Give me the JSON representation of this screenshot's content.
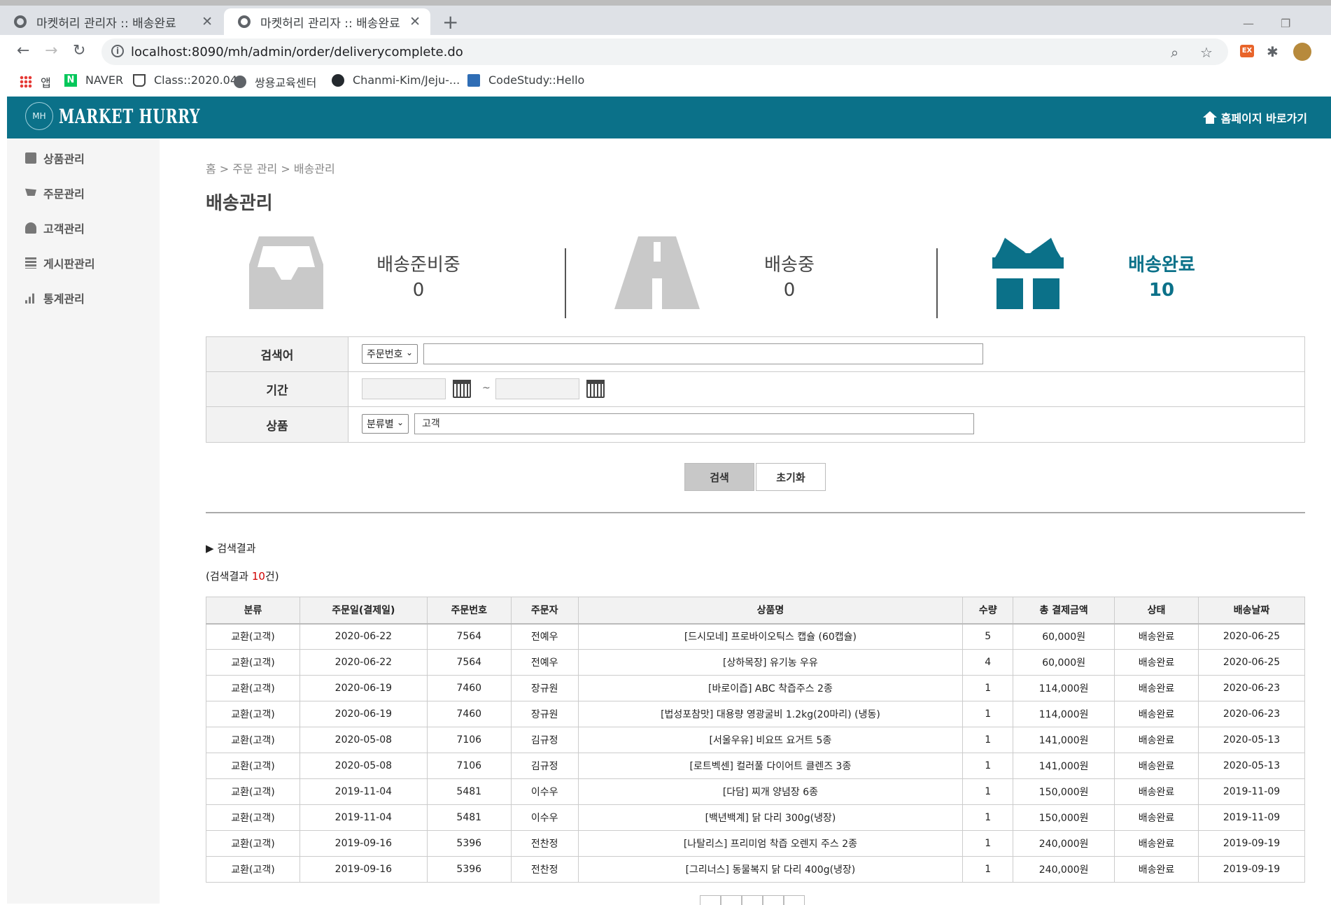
{
  "browser": {
    "tabs": [
      {
        "title": "마켓허리 관리자 :: 배송완료",
        "active": false
      },
      {
        "title": "마켓허리 관리자 :: 배송완료",
        "active": true
      }
    ],
    "url": "localhost:8090/mh/admin/order/deliverycomplete.do",
    "bookmarks": [
      {
        "label": "앱",
        "icon": "apps-icon"
      },
      {
        "label": "NAVER",
        "icon": "naver-icon"
      },
      {
        "label": "Class::2020.04",
        "icon": "coffee-icon"
      },
      {
        "label": "쌍용교육센터",
        "icon": "globe-icon"
      },
      {
        "label": "Chanmi-Kim/Jeju-...",
        "icon": "github-icon"
      },
      {
        "label": "CodeStudy::Hello",
        "icon": "monitor-icon"
      }
    ],
    "ext_ex_label": "EX"
  },
  "header": {
    "logo_mark": "MH",
    "logo_text": "MARKET HURRY",
    "home_link": "홈페이지 바로가기",
    "brand_color": "#0b7189"
  },
  "sidebar": {
    "items": [
      {
        "label": "상품관리",
        "icon": "gift-icon"
      },
      {
        "label": "주문관리",
        "icon": "cart-icon"
      },
      {
        "label": "고객관리",
        "icon": "user-icon"
      },
      {
        "label": "게시판관리",
        "icon": "list-icon"
      },
      {
        "label": "통계관리",
        "icon": "bar-chart-icon"
      }
    ]
  },
  "page": {
    "breadcrumb": "홈 > 주문 관리 > 배송관리",
    "title": "배송관리"
  },
  "status": {
    "preparing": {
      "label": "배송준비중",
      "count": "0",
      "icon": "inbox-tray-icon"
    },
    "shipping": {
      "label": "배송중",
      "count": "0",
      "icon": "road-icon"
    },
    "complete": {
      "label": "배송완료",
      "count": "10",
      "icon": "gift-box-icon",
      "active": true
    }
  },
  "search": {
    "keyword_label": "검색어",
    "keyword_select": "주문번호",
    "keyword_value": "",
    "period_label": "기간",
    "period_from": "",
    "period_to": "",
    "period_sep": "~",
    "product_label": "상품",
    "product_select": "분류별",
    "product_value": "고객",
    "search_button": "검색",
    "reset_button": "초기화"
  },
  "results": {
    "heading": "▶ 검색결과",
    "count_prefix": "(검색결과 ",
    "count": "10",
    "count_suffix": "건)",
    "columns": [
      "분류",
      "주문일(결제일)",
      "주문번호",
      "주문자",
      "상품명",
      "수량",
      "총 결제금액",
      "상태",
      "배송날짜"
    ],
    "rows": [
      [
        "교환(고객)",
        "2020-06-22",
        "7564",
        "전예우",
        "[드시모네] 프로바이오틱스 캡슐 (60캡슐)",
        "5",
        "60,000원",
        "배송완료",
        "2020-06-25"
      ],
      [
        "교환(고객)",
        "2020-06-22",
        "7564",
        "전예우",
        "[상하목장] 유기농 우유",
        "4",
        "60,000원",
        "배송완료",
        "2020-06-25"
      ],
      [
        "교환(고객)",
        "2020-06-19",
        "7460",
        "장규원",
        "[바로이즙] ABC 착즙주스 2종",
        "1",
        "114,000원",
        "배송완료",
        "2020-06-23"
      ],
      [
        "교환(고객)",
        "2020-06-19",
        "7460",
        "장규원",
        "[법성포참맛] 대용량 영광굴비 1.2kg(20마리) (냉동)",
        "1",
        "114,000원",
        "배송완료",
        "2020-06-23"
      ],
      [
        "교환(고객)",
        "2020-05-08",
        "7106",
        "김규정",
        "[서울우유] 비요뜨 요거트 5종",
        "1",
        "141,000원",
        "배송완료",
        "2020-05-13"
      ],
      [
        "교환(고객)",
        "2020-05-08",
        "7106",
        "김규정",
        "[로트벡센] 컬러풀 다이어트 클렌즈 3종",
        "1",
        "141,000원",
        "배송완료",
        "2020-05-13"
      ],
      [
        "교환(고객)",
        "2019-11-04",
        "5481",
        "이수우",
        "[다담] 찌개 양념장 6종",
        "1",
        "150,000원",
        "배송완료",
        "2019-11-09"
      ],
      [
        "교환(고객)",
        "2019-11-04",
        "5481",
        "이수우",
        "[백년백계] 닭 다리 300g(냉장)",
        "1",
        "150,000원",
        "배송완료",
        "2019-11-09"
      ],
      [
        "교환(고객)",
        "2019-09-16",
        "5396",
        "전찬정",
        "[나탈리스] 프리미엄 착즙 오렌지 주스 2종",
        "1",
        "240,000원",
        "배송완료",
        "2019-09-19"
      ],
      [
        "교환(고객)",
        "2019-09-16",
        "5396",
        "전찬정",
        "[그리너스] 동물복지 닭 다리 400g(냉장)",
        "1",
        "240,000원",
        "배송완료",
        "2019-09-19"
      ]
    ]
  }
}
